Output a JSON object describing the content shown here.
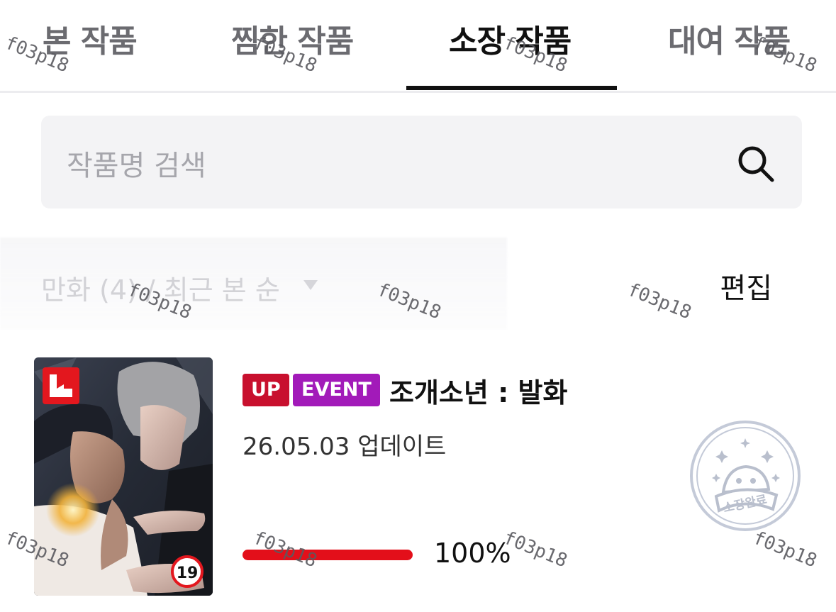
{
  "tabs": [
    {
      "label": "본 작품",
      "active": false
    },
    {
      "label": "찜한 작품",
      "active": false
    },
    {
      "label": "소장 작품",
      "active": true
    },
    {
      "label": "대여 작품",
      "active": false
    }
  ],
  "search": {
    "placeholder": "작품명 검색",
    "icon": "search-icon"
  },
  "filter": {
    "label": "만화 (4) / 최근 본 순",
    "caret_icon": "caret-down-icon"
  },
  "edit_label": "편집",
  "work": {
    "badges": [
      {
        "label": "UP",
        "color": "#c8102e"
      },
      {
        "label": "EVENT",
        "color": "#a21ab9"
      }
    ],
    "title": "조개소년 : 발화",
    "updated": "26.05.03 업데이트",
    "progress_percent": 100,
    "progress_label": "100%",
    "age_rating": "19",
    "platform_logo": "lezhin-logo-icon",
    "stamp_label": "소장완료"
  },
  "watermark_text": "f03p18",
  "colors": {
    "accent_red": "#e30f1a",
    "up_badge": "#c8102e",
    "event_badge": "#a21ab9",
    "search_bg": "#f3f3f5"
  }
}
